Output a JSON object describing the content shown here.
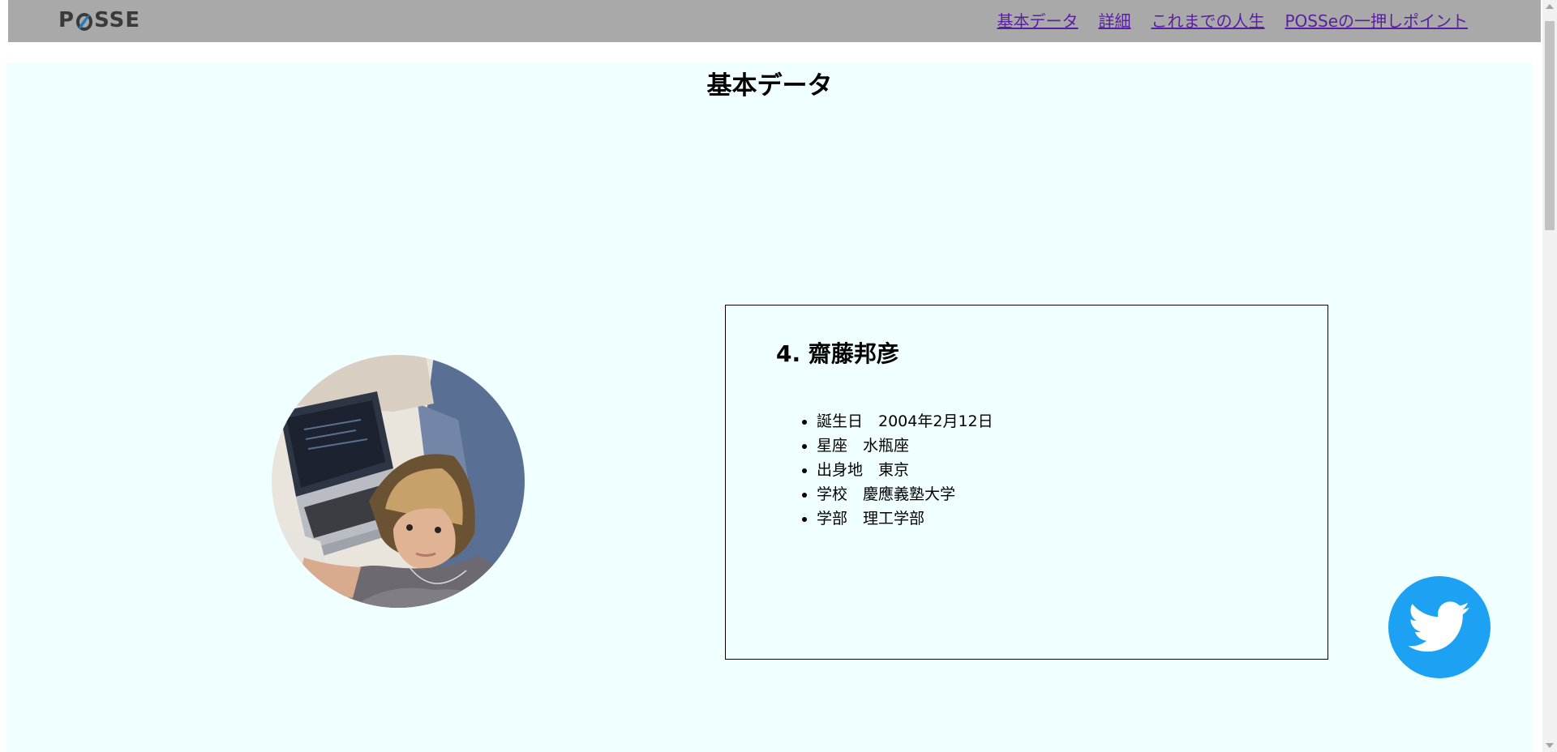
{
  "header": {
    "logo_text_left": "P",
    "logo_text_right": "SSE",
    "nav": [
      {
        "label": "基本データ"
      },
      {
        "label": "詳細"
      },
      {
        "label": "これまでの人生"
      },
      {
        "label": "POSSeの一押しポイント"
      }
    ]
  },
  "section": {
    "title": "基本データ",
    "person": {
      "name": "4. 齋藤邦彦",
      "details": [
        "誕生日　2004年2月12日",
        "星座　水瓶座",
        "出身地　東京",
        "学校　慶應義塾大学",
        "学部　理工学部"
      ]
    }
  },
  "icons": {
    "twitter": "twitter-bird-icon",
    "avatar": "profile-photo"
  },
  "colors": {
    "header_bg": "#a9a9a9",
    "section_bg": "#f0ffff",
    "link": "#5a1fa0",
    "twitter": "#1da1f2",
    "logo_accent": "#1a7fc9"
  }
}
